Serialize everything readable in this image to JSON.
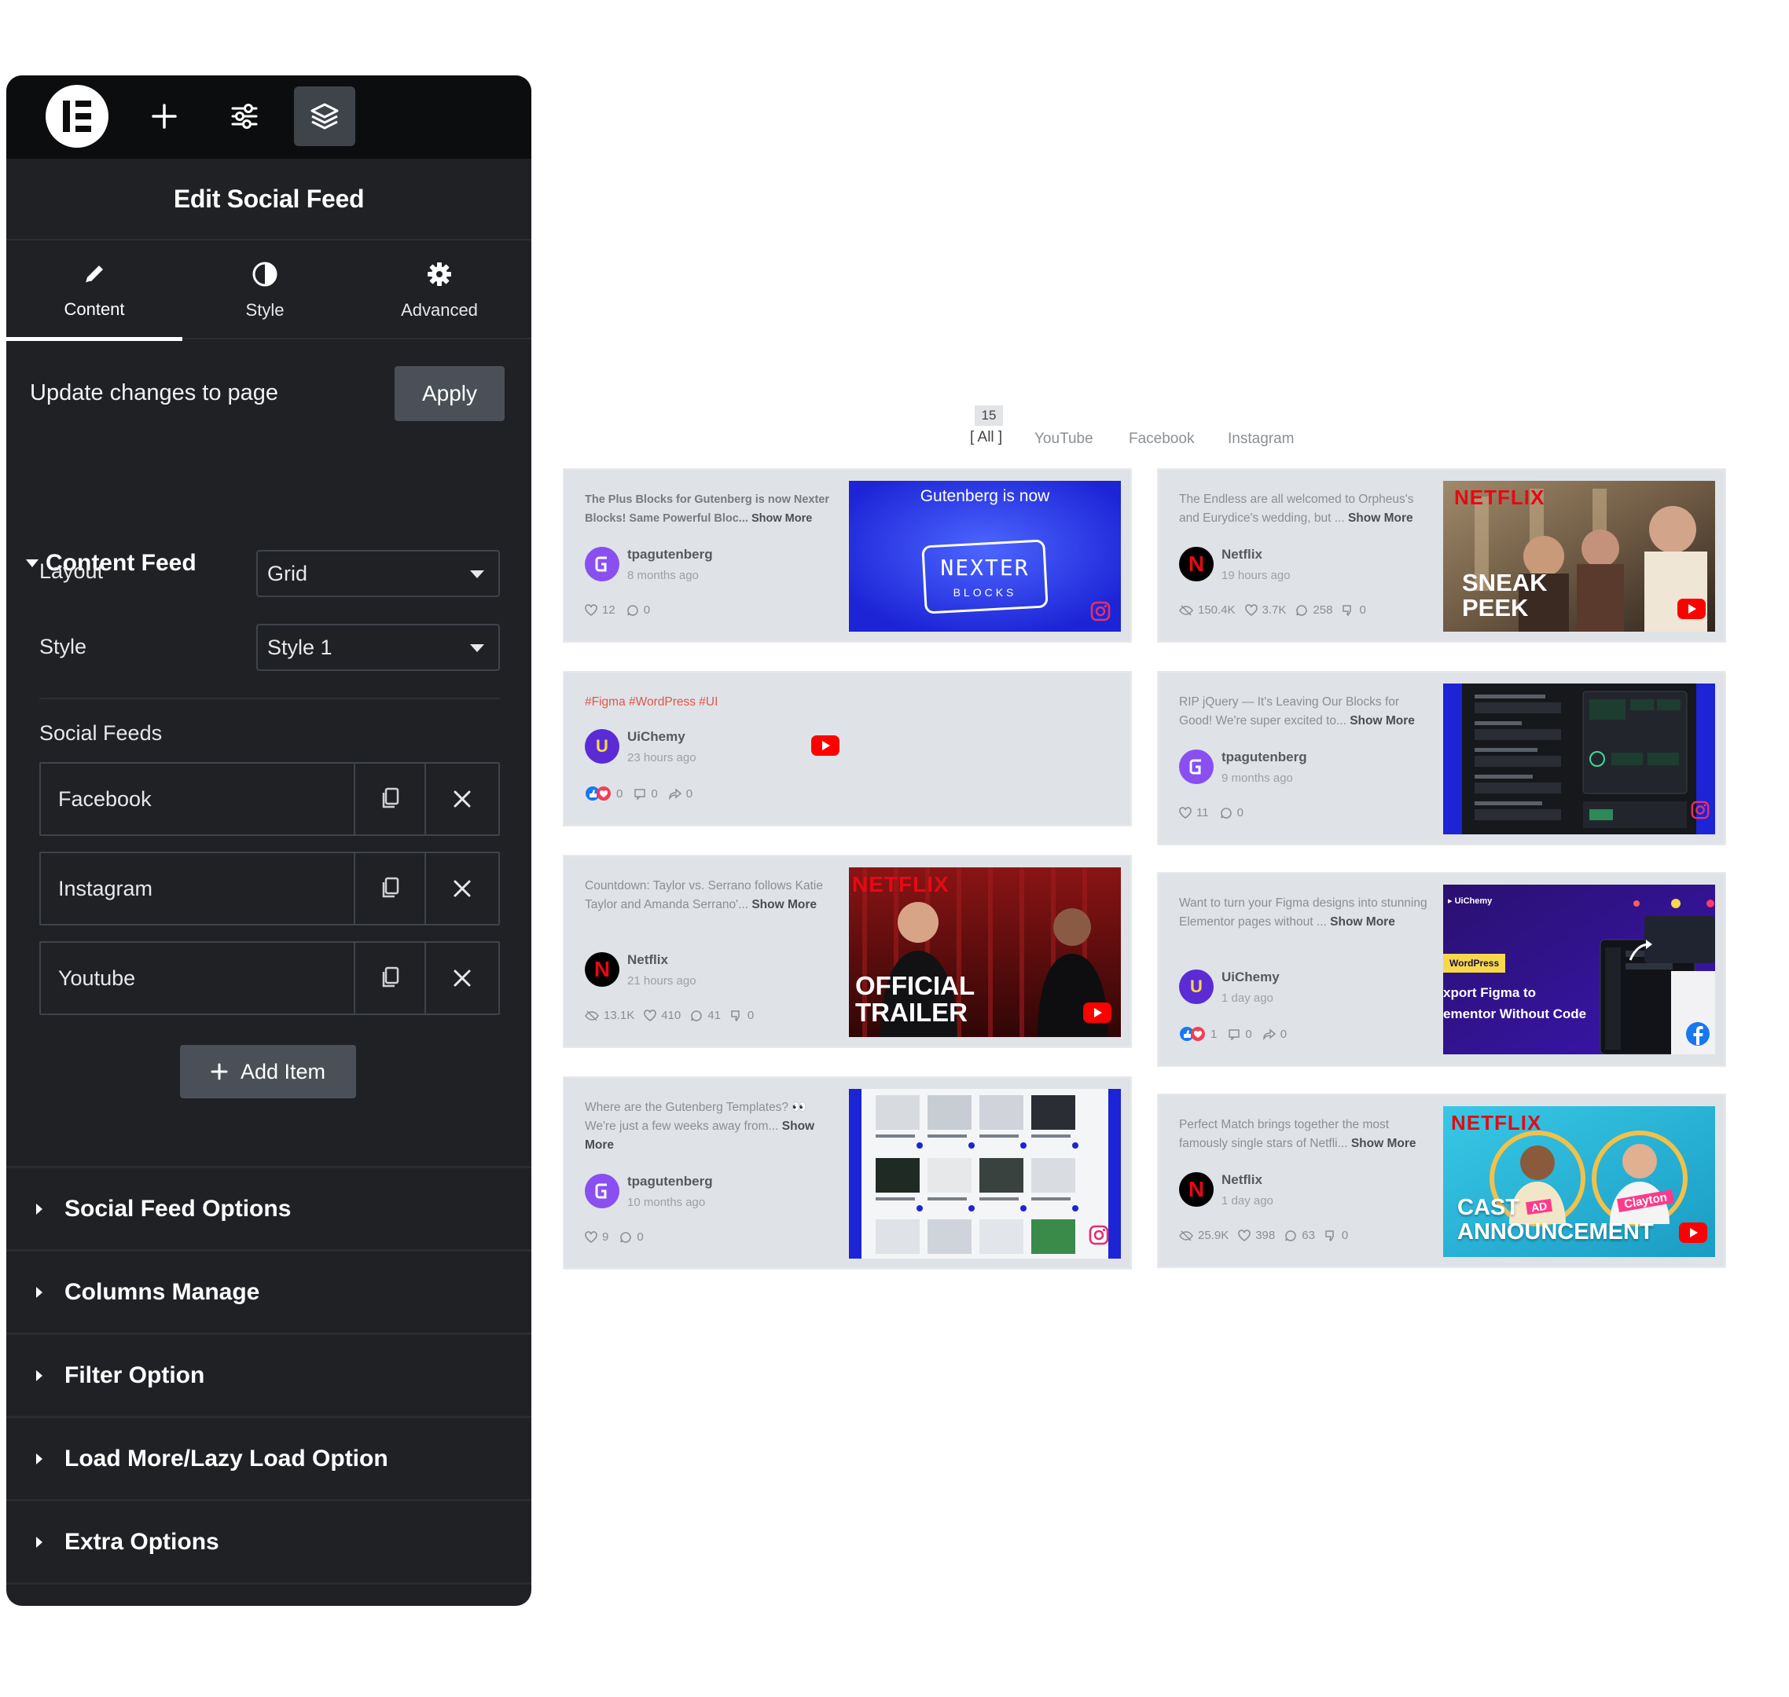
{
  "panel": {
    "title": "Edit Social Feed",
    "tabs": [
      {
        "label": "Content",
        "icon": "pencil-icon",
        "active": true
      },
      {
        "label": "Style",
        "icon": "contrast-icon"
      },
      {
        "label": "Advanced",
        "icon": "gear-icon"
      }
    ],
    "update_text": "Update changes to page",
    "apply_label": "Apply",
    "content_feed": {
      "title": "Content Feed",
      "layout_label": "Layout",
      "layout_value": "Grid",
      "style_label": "Style",
      "style_value": "Style 1",
      "social_feeds_label": "Social Feeds",
      "feeds": [
        "Facebook",
        "Instagram",
        "Youtube"
      ],
      "add_item_label": "Add Item"
    },
    "sections": [
      "Social Feed Options",
      "Columns Manage",
      "Filter Option",
      "Load More/Lazy Load Option",
      "Extra Options"
    ]
  },
  "filters": {
    "all_count": "15",
    "all_label": "All",
    "items": [
      "YouTube",
      "Facebook",
      "Instagram"
    ]
  },
  "cards": [
    {
      "text": "The Plus Blocks for Gutenberg is now Nexter Blocks! Same Powerful Bloc...",
      "more": "Show More",
      "author": "tpagutenberg",
      "time": "8 months ago",
      "likes": "12",
      "comments": "0",
      "thumb_title": "Gutenberg is now",
      "thumb_logo": "NEXTER",
      "thumb_sub": "BLOCKS"
    },
    {
      "text": "The Endless are all welcomed to Orpheus's and Eurydice's wedding, but ...",
      "more": "Show More",
      "author": "Netflix",
      "time": "19 hours ago",
      "views": "150.4K",
      "likes": "3.7K",
      "comments": "258",
      "dislikes": "0",
      "thumb_brand": "NETFLIX",
      "thumb_line1": "SNEAK",
      "thumb_line2": "PEEK"
    },
    {
      "text": "#Figma #WordPress #UI",
      "author": "UiChemy",
      "time": "23 hours ago",
      "reactions": "0",
      "comments": "0",
      "shares": "0"
    },
    {
      "text": "RIP jQuery — It's Leaving Our Blocks for Good! We're super excited to...",
      "more": "Show More",
      "author": "tpagutenberg",
      "time": "9 months ago",
      "likes": "11",
      "comments": "0"
    },
    {
      "text": "Countdown: Taylor vs. Serrano follows Katie Taylor and Amanda Serrano'...",
      "more": "Show More",
      "author": "Netflix",
      "time": "21 hours ago",
      "views": "13.1K",
      "likes": "410",
      "comments": "41",
      "dislikes": "0",
      "thumb_brand": "NETFLIX",
      "thumb_line1": "OFFICIAL",
      "thumb_line2": "TRAILER"
    },
    {
      "text": "Want to turn your Figma designs into stunning Elementor pages without ...",
      "more": "Show More",
      "author": "UiChemy",
      "time": "1 day ago",
      "reactions": "1",
      "comments": "0",
      "shares": "0",
      "thumb_brand": "UiChemy",
      "thumb_tag": "WordPress",
      "thumb_line1": "xport Figma to",
      "thumb_line2": "ementor Without Code"
    },
    {
      "text": "Where are the Gutenberg Templates? 👀 We're just a few weeks away from...",
      "more": "Show More",
      "author": "tpagutenberg",
      "time": "10 months ago",
      "likes": "9",
      "comments": "0"
    },
    {
      "text": "Perfect Match brings together the most famously single stars of Netfli...",
      "more": "Show More",
      "author": "Netflix",
      "time": "1 day ago",
      "views": "25.9K",
      "likes": "398",
      "comments": "63",
      "dislikes": "0",
      "thumb_brand": "NETFLIX",
      "thumb_line1": "CAST",
      "thumb_line2": "ANNOUNCEMENT",
      "thumb_tag1": "AD",
      "thumb_tag2": "Clayton"
    }
  ],
  "colors": {
    "panel_bg": "#1f2124",
    "topbar_bg": "#0c0d0e",
    "card_bg": "#dfe3e7",
    "netflix_red": "#e50914",
    "youtube_red": "#ff0000",
    "instagram_pink": "#e1306c",
    "facebook_blue": "#1877f2",
    "nexter_blue": "#1c24d6"
  }
}
